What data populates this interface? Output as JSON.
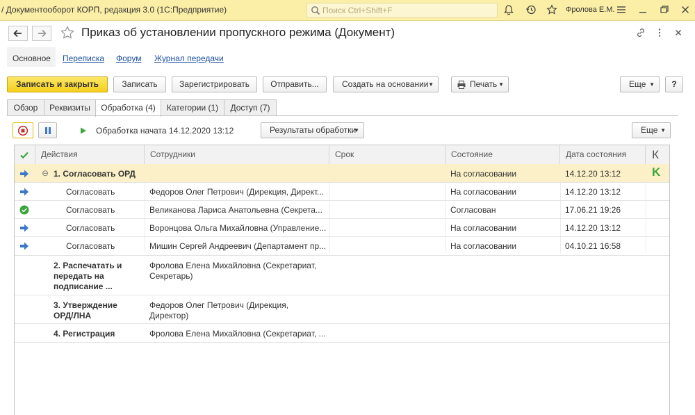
{
  "window": {
    "app_title": "/ Документооборот КОРП, редакция 3.0  (1С:Предприятие)",
    "search_placeholder": "Поиск Ctrl+Shift+F",
    "user": "Фролова Е.М."
  },
  "document": {
    "title": "Приказ об установлении пропускного режима (Документ)"
  },
  "links": [
    "Основное",
    "Переписка",
    "Форум",
    "Журнал передачи"
  ],
  "toolbar": {
    "save_close": "Записать и закрыть",
    "save": "Записать",
    "register": "Зарегистрировать",
    "send": "Отправить...",
    "create_based": "Создать на основании",
    "print": "Печать",
    "more": "Еще",
    "help": "?"
  },
  "tabs": [
    "Обзор",
    "Реквизиты",
    "Обработка (4)",
    "Категории (1)",
    "Доступ (7)"
  ],
  "process": {
    "status": "Обработка начата 14.12.2020 13:12",
    "results": "Результаты обработки",
    "more": "Еще"
  },
  "table": {
    "headers": [
      "Действия",
      "Сотрудники",
      "Срок",
      "Состояние",
      "Дата состояния",
      "К"
    ],
    "rows": [
      {
        "action": "1. Согласовать ОРД",
        "employee": "",
        "deadline": "",
        "state": "На согласовании",
        "date": "14.12.20 13:12",
        "k": "K",
        "icon": "arrow-icon"
      },
      {
        "action": "Согласовать",
        "employee": "Федоров Олег Петрович (Дирекция, Директ...",
        "deadline": "",
        "state": "На согласовании",
        "date": "14.12.20 13:12",
        "k": "",
        "icon": "arrow-icon"
      },
      {
        "action": "Согласовать",
        "employee": "Великанова Лариса Анатольевна (Секрета...",
        "deadline": "",
        "state": "Согласован",
        "date": "17.06.21 19:26",
        "k": "",
        "icon": "check-icon"
      },
      {
        "action": "Согласовать",
        "employee": "Воронцова Ольга Михайловна (Управление...",
        "deadline": "",
        "state": "На согласовании",
        "date": "14.12.20 13:12",
        "k": "",
        "icon": "arrow-icon"
      },
      {
        "action": "Согласовать",
        "employee": "Мишин Сергей Андреевич (Департамент пр...",
        "deadline": "",
        "state": "На согласовании",
        "date": "04.10.21 16:58",
        "k": "",
        "icon": "arrow-icon"
      },
      {
        "action": "2. Распечатать и передать на подписание ...",
        "employee": "Фролова Елена Михайловна (Секретариат, Секретарь)",
        "deadline": "",
        "state": "",
        "date": "",
        "k": "",
        "icon": ""
      },
      {
        "action": "3. Утверждение ОРД/ЛНА",
        "employee": "Федоров Олег Петрович (Дирекция, Директор)",
        "deadline": "",
        "state": "",
        "date": "",
        "k": "",
        "icon": ""
      },
      {
        "action": "4. Регистрация",
        "employee": "Фролова Елена Михайловна (Секретариат, ...",
        "deadline": "",
        "state": "",
        "date": "",
        "k": "",
        "icon": ""
      }
    ]
  },
  "colors": {
    "title_bar": "#fbeea6",
    "primary_button": "#f5cf1b",
    "link": "#1b4ea3",
    "selected_row": "#fbf0c8",
    "green": "#3aa53a",
    "blue_arrow": "#3c78c8"
  }
}
